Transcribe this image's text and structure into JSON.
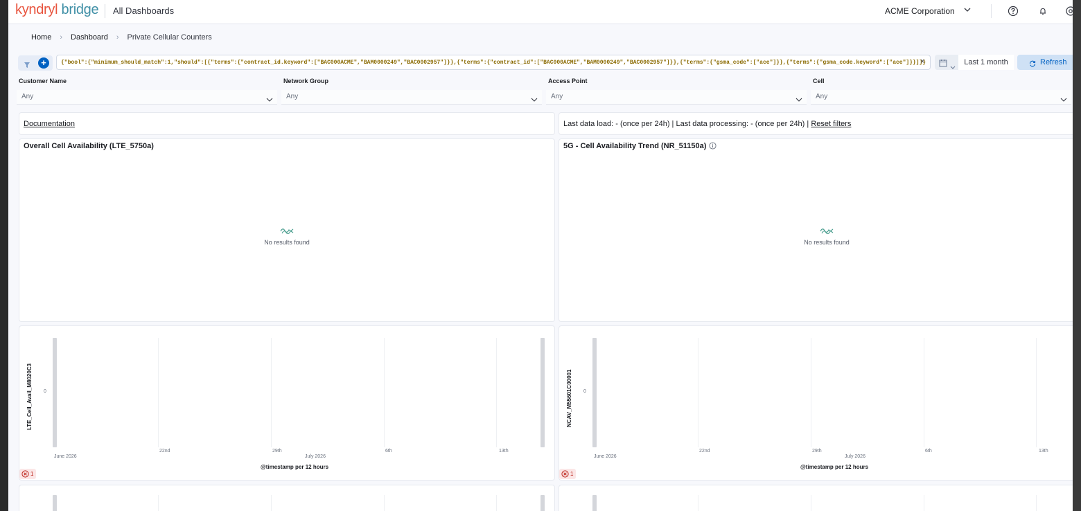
{
  "header": {
    "logo_kyndryl": "kyndryl",
    "logo_bridge": "bridge",
    "title": "All Dashboards",
    "org": "ACME Corporation",
    "icons": [
      "help-icon",
      "bell-icon",
      "settings-icon"
    ]
  },
  "breadcrumbs": [
    "Home",
    "Dashboard",
    "Private Cellular Counters"
  ],
  "query": {
    "text": "{\"bool\":{\"minimum_should_match\":1,\"should\":[{\"terms\":{\"contract_id.keyword\":[\"BAC000ACME\",\"BAM0000249\",\"BAC0002957\"]}},{\"terms\":{\"contract_id\":[\"BAC000ACME\",\"BAM0000249\",\"BAC0002957\"]}},{\"terms\":{\"gsma_code\":[\"ace\"]}},{\"terms\":{\"gsma_code.keyword\":[\"ace\"]}}]}}",
    "clear": "×",
    "date_range": "Last 1 month",
    "refresh": "Refresh"
  },
  "controls": [
    {
      "label": "Customer Name",
      "value": "Any"
    },
    {
      "label": "Network Group",
      "value": "Any"
    },
    {
      "label": "Access Point",
      "value": "Any"
    },
    {
      "label": "Cell",
      "value": "Any"
    }
  ],
  "info_bar": {
    "documentation": "Documentation",
    "last_load": "Last data load: - (once per 24h) | Last data processing: - (once per 24h) |",
    "reset": "Reset filters"
  },
  "panels": {
    "overall": {
      "title": "Overall Cell Availability (LTE_5750a)",
      "empty": "No results found"
    },
    "trend5g": {
      "title": "5G - Cell Availability Trend (NR_51150a)",
      "empty": "No results found"
    }
  },
  "charts": [
    {
      "ylabel": "LTE_Cell_Avail_M8020C3",
      "ytick": "0",
      "xticks": [
        "June 2026",
        "22nd",
        "29th",
        "July 2026",
        "6th",
        "13th"
      ],
      "xlabel": "@timestamp per 12 hours",
      "errors": "1"
    },
    {
      "ylabel": "NCAV_M55601C00001",
      "ytick": "0",
      "xticks": [
        "June 2026",
        "22nd",
        "29th",
        "July 2026",
        "6th",
        "13th"
      ],
      "xlabel": "@timestamp per 12 hours",
      "errors": "1"
    }
  ],
  "colors": {
    "brand_red": "#e8543e",
    "brand_teal": "#3f8fa6",
    "link_blue": "#0061c2",
    "error_red": "#bd271e"
  }
}
